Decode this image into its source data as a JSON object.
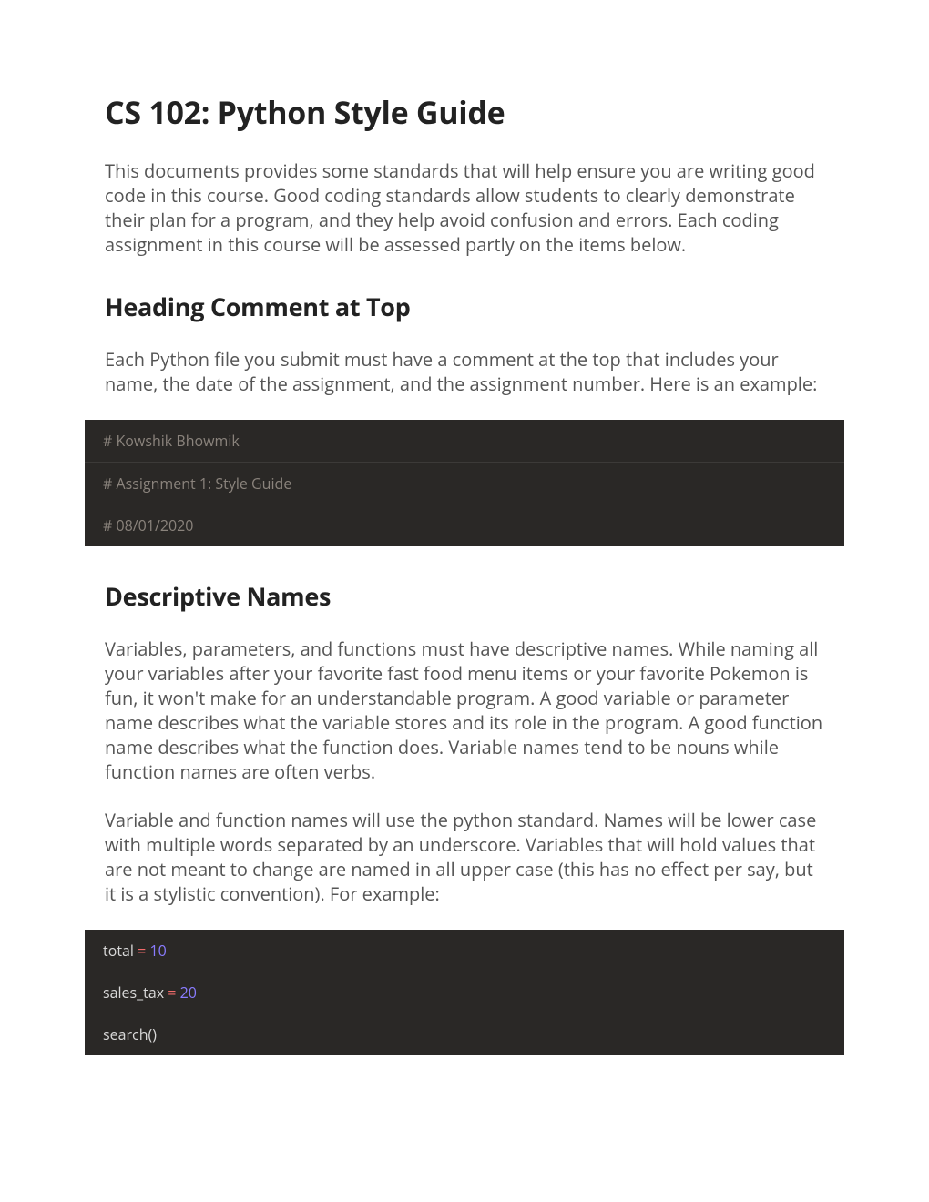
{
  "title": "CS 102: Python Style Guide",
  "intro": "This documents provides some standards that will help ensure you are writing good code in this course. Good coding standards allow students to clearly demonstrate their plan for a program, and they help avoid confusion and errors. Each coding assignment in this course will be assessed partly on the items below.",
  "section1": {
    "heading": "Heading Comment at Top",
    "text": "Each Python file you submit must have a comment at the top that includes your name, the date of the assignment, and the assignment number. Here is an example:",
    "code": {
      "l1": "# Kowshik Bhowmik",
      "l2": "# Assignment 1: Style Guide",
      "l3": "# 08/01/2020"
    }
  },
  "section2": {
    "heading": "Descriptive Names",
    "p1": "Variables, parameters, and functions must have descriptive names. While naming all your variables after your favorite fast food menu items or your favorite Pokemon is fun, it won't make for an understandable program. A good variable or parameter name describes what the variable stores and its role in the program. A good function name describes what the function does. Variable names tend to be nouns while function names are often verbs.",
    "p2": "Variable and function names will use the python standard. Names will be lower case with multiple words separated by an underscore. Variables that will hold values that are not meant to change are named in all upper case (this has no effect per say, but it is a stylistic convention). For example:",
    "code": {
      "l1_var": "total ",
      "l1_op": "= ",
      "l1_val": "10",
      "l2_var": "sales_tax ",
      "l2_op": "= ",
      "l2_val": "20",
      "l3": "search()"
    }
  }
}
